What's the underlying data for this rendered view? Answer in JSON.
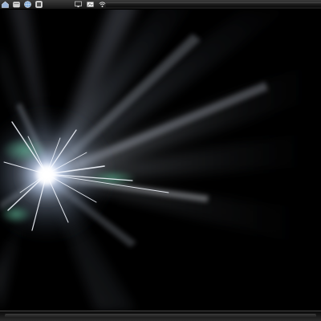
{
  "top_panel": {
    "launchers": [
      {
        "icon": "home-folder-icon",
        "color": "#9ab4d8"
      },
      {
        "icon": "file-manager-icon",
        "color": "#cfcfcf"
      },
      {
        "icon": "globe-icon",
        "color": "#7aa6d6"
      },
      {
        "icon": "system-tools-icon",
        "color": "#d8d8d8"
      }
    ],
    "tray": [
      {
        "icon": "monitor-icon"
      },
      {
        "icon": "display-settings-icon"
      },
      {
        "icon": "wifi-icon"
      }
    ]
  },
  "desktop": {
    "wallpaper": "abstract-light-burst",
    "accent_colors": [
      "#ffffff",
      "#bcd6ff",
      "#6fd9b0"
    ]
  },
  "bottom_panel": {
    "taskbar": "empty"
  }
}
